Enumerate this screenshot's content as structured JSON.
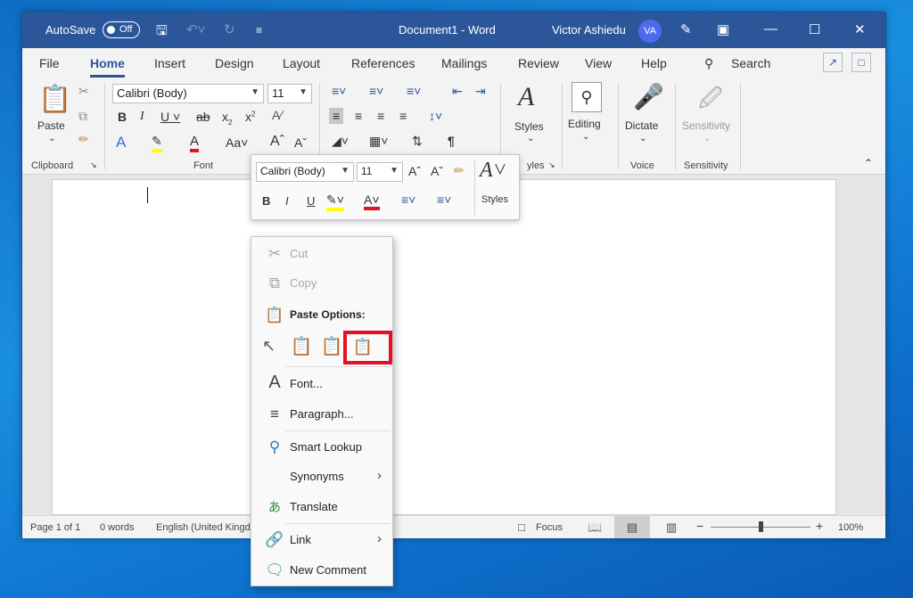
{
  "titlebar": {
    "autosave_label": "AutoSave",
    "autosave_state": "Off",
    "document_title": "Document1  -  Word",
    "user_name": "Victor Ashiedu",
    "user_initials": "VA"
  },
  "tabs": [
    "File",
    "Home",
    "Insert",
    "Design",
    "Layout",
    "References",
    "Mailings",
    "Review",
    "View",
    "Help"
  ],
  "search_label": "Search",
  "ribbon": {
    "clipboard": {
      "paste_label": "Paste",
      "group_label": "Clipboard"
    },
    "font": {
      "font_name": "Calibri (Body)",
      "font_size": "11",
      "group_label": "Font"
    },
    "paragraph": {
      "group_label_partial": "yles"
    },
    "styles": {
      "label": "Styles"
    },
    "editing": {
      "label": "Editing"
    },
    "voice": {
      "dictate_label": "Dictate",
      "group_label": "Voice"
    },
    "sensitivity": {
      "label": "Sensitivity",
      "group_label": "Sensitivity"
    }
  },
  "mini_toolbar": {
    "font_name": "Calibri (Body)",
    "font_size": "11",
    "styles_label": "Styles"
  },
  "context_menu": {
    "cut": "Cut",
    "copy": "Copy",
    "paste_options": "Paste Options:",
    "font": "Font...",
    "paragraph": "Paragraph...",
    "smart_lookup": "Smart Lookup",
    "synonyms": "Synonyms",
    "translate": "Translate",
    "link": "Link",
    "new_comment": "New Comment"
  },
  "status": {
    "page": "Page 1 of 1",
    "words": "0 words",
    "language": "English (United Kingd",
    "focus": "Focus",
    "zoom": "100%"
  },
  "colors": {
    "accent": "#2b579a",
    "highlight_box": "#e81123",
    "font_color": "#e81123",
    "highlight_color": "#ffff00"
  }
}
